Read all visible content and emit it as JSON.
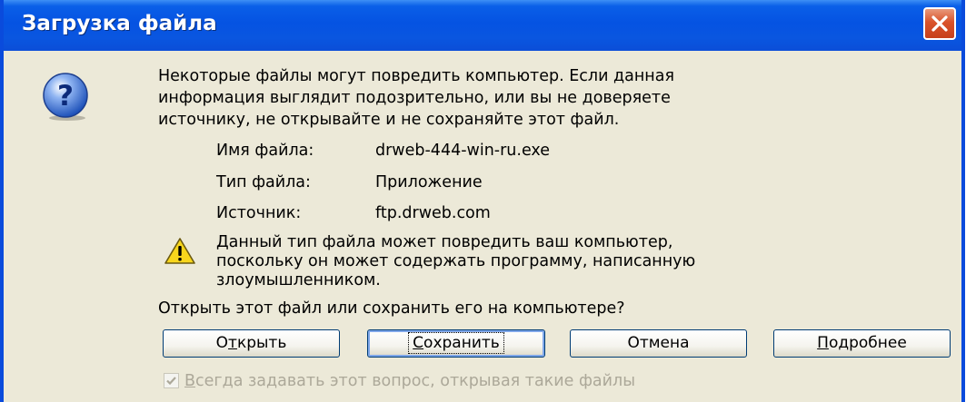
{
  "window": {
    "title": "Загрузка файла"
  },
  "dialog": {
    "icon": "question-icon",
    "intro_line1": "Некоторые файлы могут повредить компьютер. Если данная",
    "intro_line2": "информация выглядит подозрительно, или вы не доверяете",
    "intro_line3": "источнику, не открывайте и не сохраняйте этот файл.",
    "fields": [
      {
        "label": "Имя файла:",
        "value": "drweb-444-win-ru.exe"
      },
      {
        "label": "Тип файла:",
        "value": "Приложение"
      },
      {
        "label": "Источник:",
        "value": "ftp.drweb.com"
      }
    ],
    "warning_icon": "warning-icon",
    "warning_line1": "Данный тип файла может повредить ваш компьютер,",
    "warning_line2": "поскольку он может содержать программу, написанную",
    "warning_line3": "злоумышленником.",
    "question": "Открыть этот файл или сохранить его на компьютере?"
  },
  "buttons": {
    "open": {
      "pre": "О",
      "accel": "т",
      "post": "крыть"
    },
    "save": {
      "pre": "",
      "accel": "С",
      "post": "охранить"
    },
    "cancel": {
      "label": "Отмена"
    },
    "details": {
      "pre": "",
      "accel": "П",
      "post": "одробнее"
    }
  },
  "checkbox": {
    "checked": true,
    "accel": "В",
    "rest": "сегда задавать этот вопрос, открывая такие файлы"
  },
  "colors": {
    "title_bar": "#0553e2",
    "face": "#ece9d8",
    "close": "#d9522a",
    "disabled_text": "#aca899"
  }
}
